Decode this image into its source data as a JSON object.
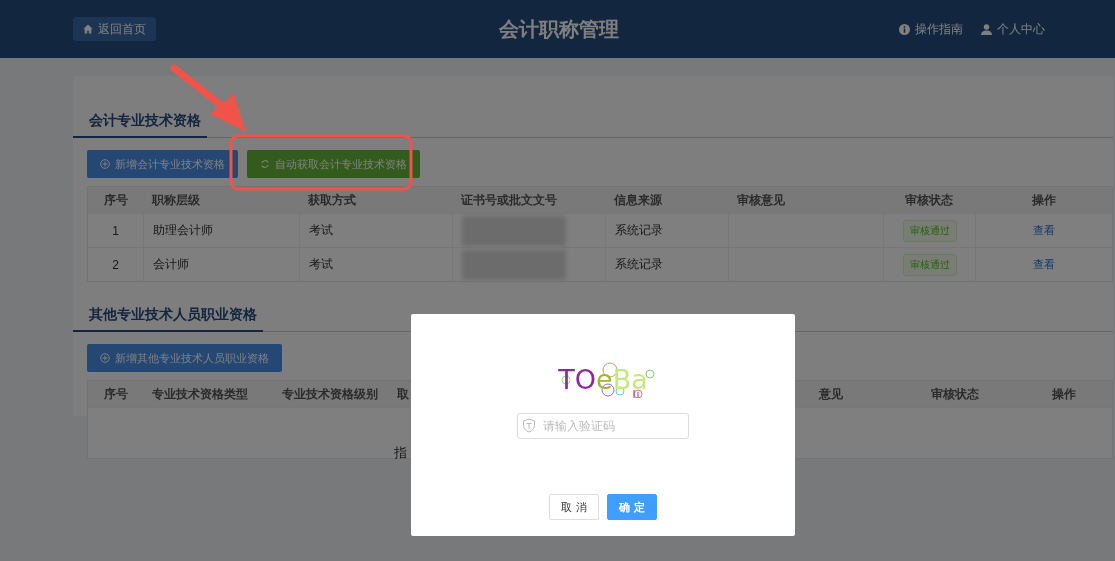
{
  "header": {
    "back_button": "返回首页",
    "title": "会计职称管理",
    "links": [
      {
        "label": "操作指南",
        "kind": "info"
      },
      {
        "label": "个人中心",
        "kind": "user"
      }
    ]
  },
  "section_1": {
    "title": "会计专业技术资格",
    "buttons": [
      {
        "label": "新增会计专业技术资格",
        "kind": "add"
      },
      {
        "label": "自动获取会计专业技术资格",
        "kind": "refresh"
      }
    ],
    "table": {
      "columns": [
        "序号",
        "职称层级",
        "获取方式",
        "证书号或批文文号",
        "信息来源",
        "审核意见",
        "审核状态",
        "操作"
      ],
      "rows": [
        {
          "number": "1",
          "level": "助理会计师",
          "method": "考试",
          "source": "系统记录",
          "status": "审核通过",
          "action": "查看"
        },
        {
          "number": "2",
          "level": "会计师",
          "method": "考试",
          "source": "系统记录",
          "status": "审核通过",
          "action": "查看"
        }
      ]
    }
  },
  "section_2": {
    "title": "其他专业技术人员职业资格",
    "buttons": [
      {
        "label": "新增其他专业技术人员职业资格",
        "kind": "add"
      }
    ],
    "table": {
      "columns": [
        "序号",
        "专业技术资格类型",
        "专业技术资格级别",
        "取",
        "意见",
        "审核状态",
        "操作"
      ]
    }
  },
  "footer_text": "指",
  "modal": {
    "captcha": "TOeBa",
    "placeholder": "请输入验证码",
    "buttons": [
      {
        "label": "取 消",
        "kind": "default"
      },
      {
        "label": "确 定",
        "kind": "primary"
      }
    ]
  }
}
